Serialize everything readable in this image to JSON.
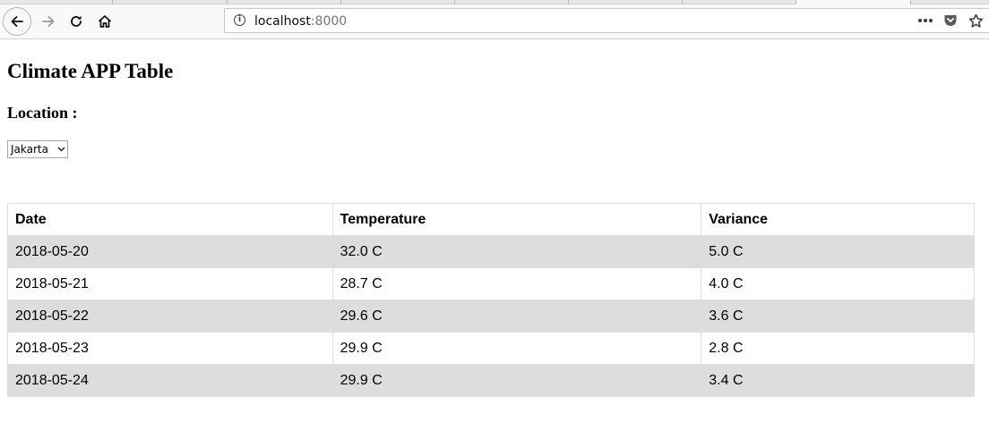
{
  "browser": {
    "url_host": "localhost",
    "url_port": ":8000"
  },
  "page": {
    "title": "Climate APP Table",
    "location_label": "Location :",
    "location_select": {
      "selected": "Jakarta"
    },
    "table": {
      "headers": [
        "Date",
        "Temperature",
        "Variance"
      ],
      "rows": [
        [
          "2018-05-20",
          "32.0 C",
          "5.0 C"
        ],
        [
          "2018-05-21",
          "28.7 C",
          "4.0 C"
        ],
        [
          "2018-05-22",
          "29.6 C",
          "3.6 C"
        ],
        [
          "2018-05-23",
          "29.9 C",
          "2.8 C"
        ],
        [
          "2018-05-24",
          "29.9 C",
          "3.4 C"
        ]
      ]
    }
  },
  "colors": {
    "striped_row": "#dddddd",
    "border": "#dddddd",
    "pocket_icon": "#5a5a5a"
  },
  "icons": [
    "back-arrow-icon",
    "forward-arrow-icon",
    "reload-icon",
    "home-icon",
    "info-icon",
    "more-actions-icon",
    "pocket-icon",
    "bookmark-star-icon",
    "chevron-down-icon"
  ]
}
